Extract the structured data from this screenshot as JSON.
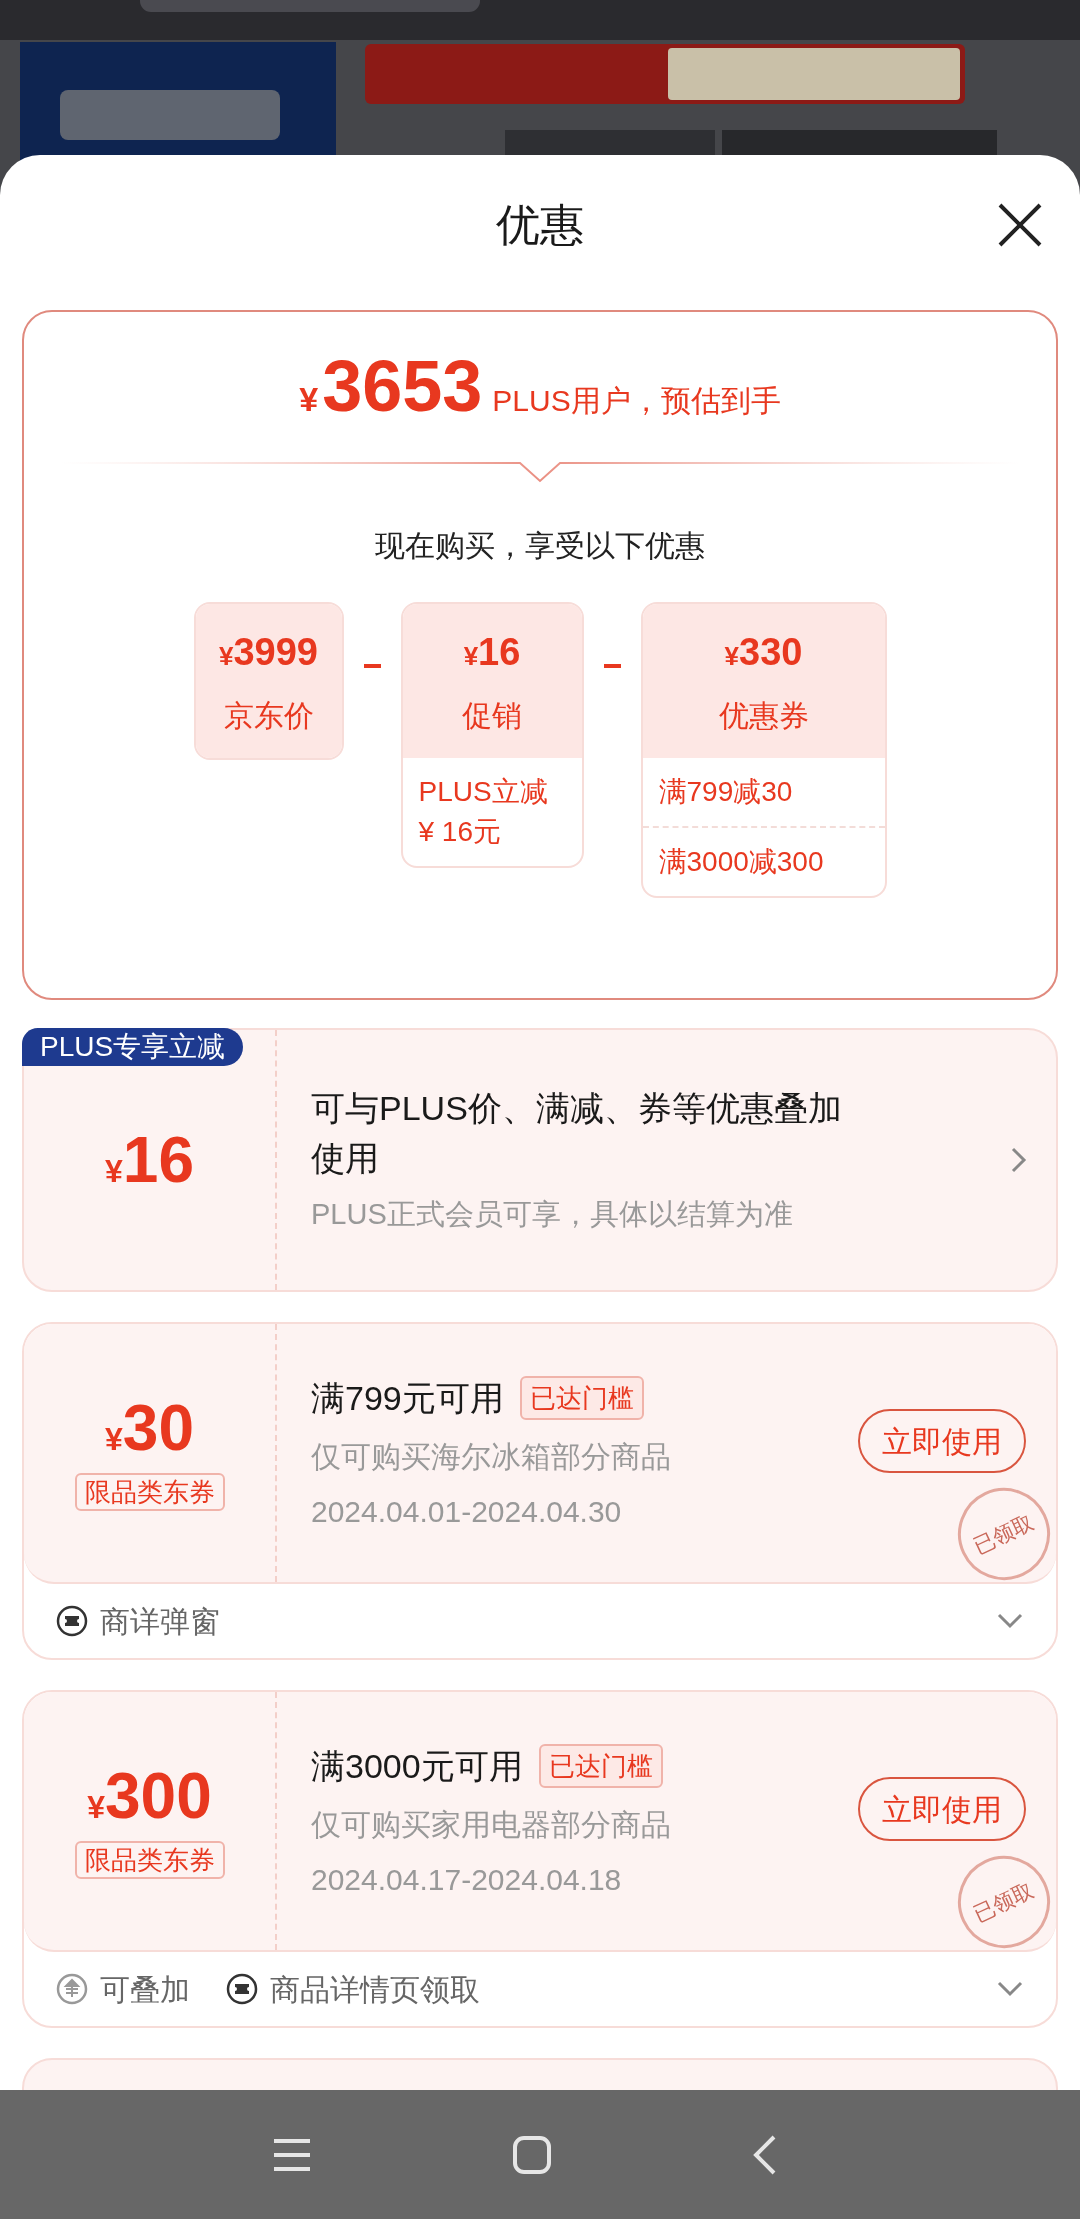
{
  "sheet": {
    "title": "优惠"
  },
  "summary": {
    "currency": "¥",
    "price": "3653",
    "price_note": "PLUS用户，预估到手",
    "intro": "现在购买，享受以下优惠",
    "breakdown": [
      {
        "currency": "¥",
        "amount": "3999",
        "label": "京东价"
      },
      {
        "currency": "¥",
        "amount": "16",
        "label": "促销",
        "details": [
          "PLUS立减\n¥ 16元"
        ]
      },
      {
        "currency": "¥",
        "amount": "330",
        "label": "优惠券",
        "details": [
          "满799减30",
          "满3000减300"
        ]
      }
    ]
  },
  "coupons": [
    {
      "kind": "plus",
      "badge": "PLUS专享立减",
      "currency": "¥",
      "amount": "16",
      "title": "可与PLUS价、满减、券等优惠叠加使用",
      "note": "PLUS正式会员可享，具体以结算为准"
    },
    {
      "kind": "coupon",
      "currency": "¥",
      "amount": "30",
      "tag": "限品类东券",
      "title": "满799元可用",
      "status": "已达门槛",
      "scope": "仅可购买海尔冰箱部分商品",
      "dates": "2024.04.01-2024.04.30",
      "action": "立即使用",
      "stamp": "已领取",
      "footer": [
        {
          "kind": "ticket",
          "label": "商详弹窗"
        }
      ]
    },
    {
      "kind": "coupon",
      "currency": "¥",
      "amount": "300",
      "tag": "限品类东券",
      "title": "满3000元可用",
      "status": "已达门槛",
      "scope": "仅可购买家用电器部分商品",
      "dates": "2024.04.17-2024.04.18",
      "action": "立即使用",
      "stamp": "已领取",
      "footer": [
        {
          "kind": "stack",
          "label": "可叠加"
        },
        {
          "kind": "ticket",
          "label": "商品详情页领取"
        }
      ]
    }
  ]
}
